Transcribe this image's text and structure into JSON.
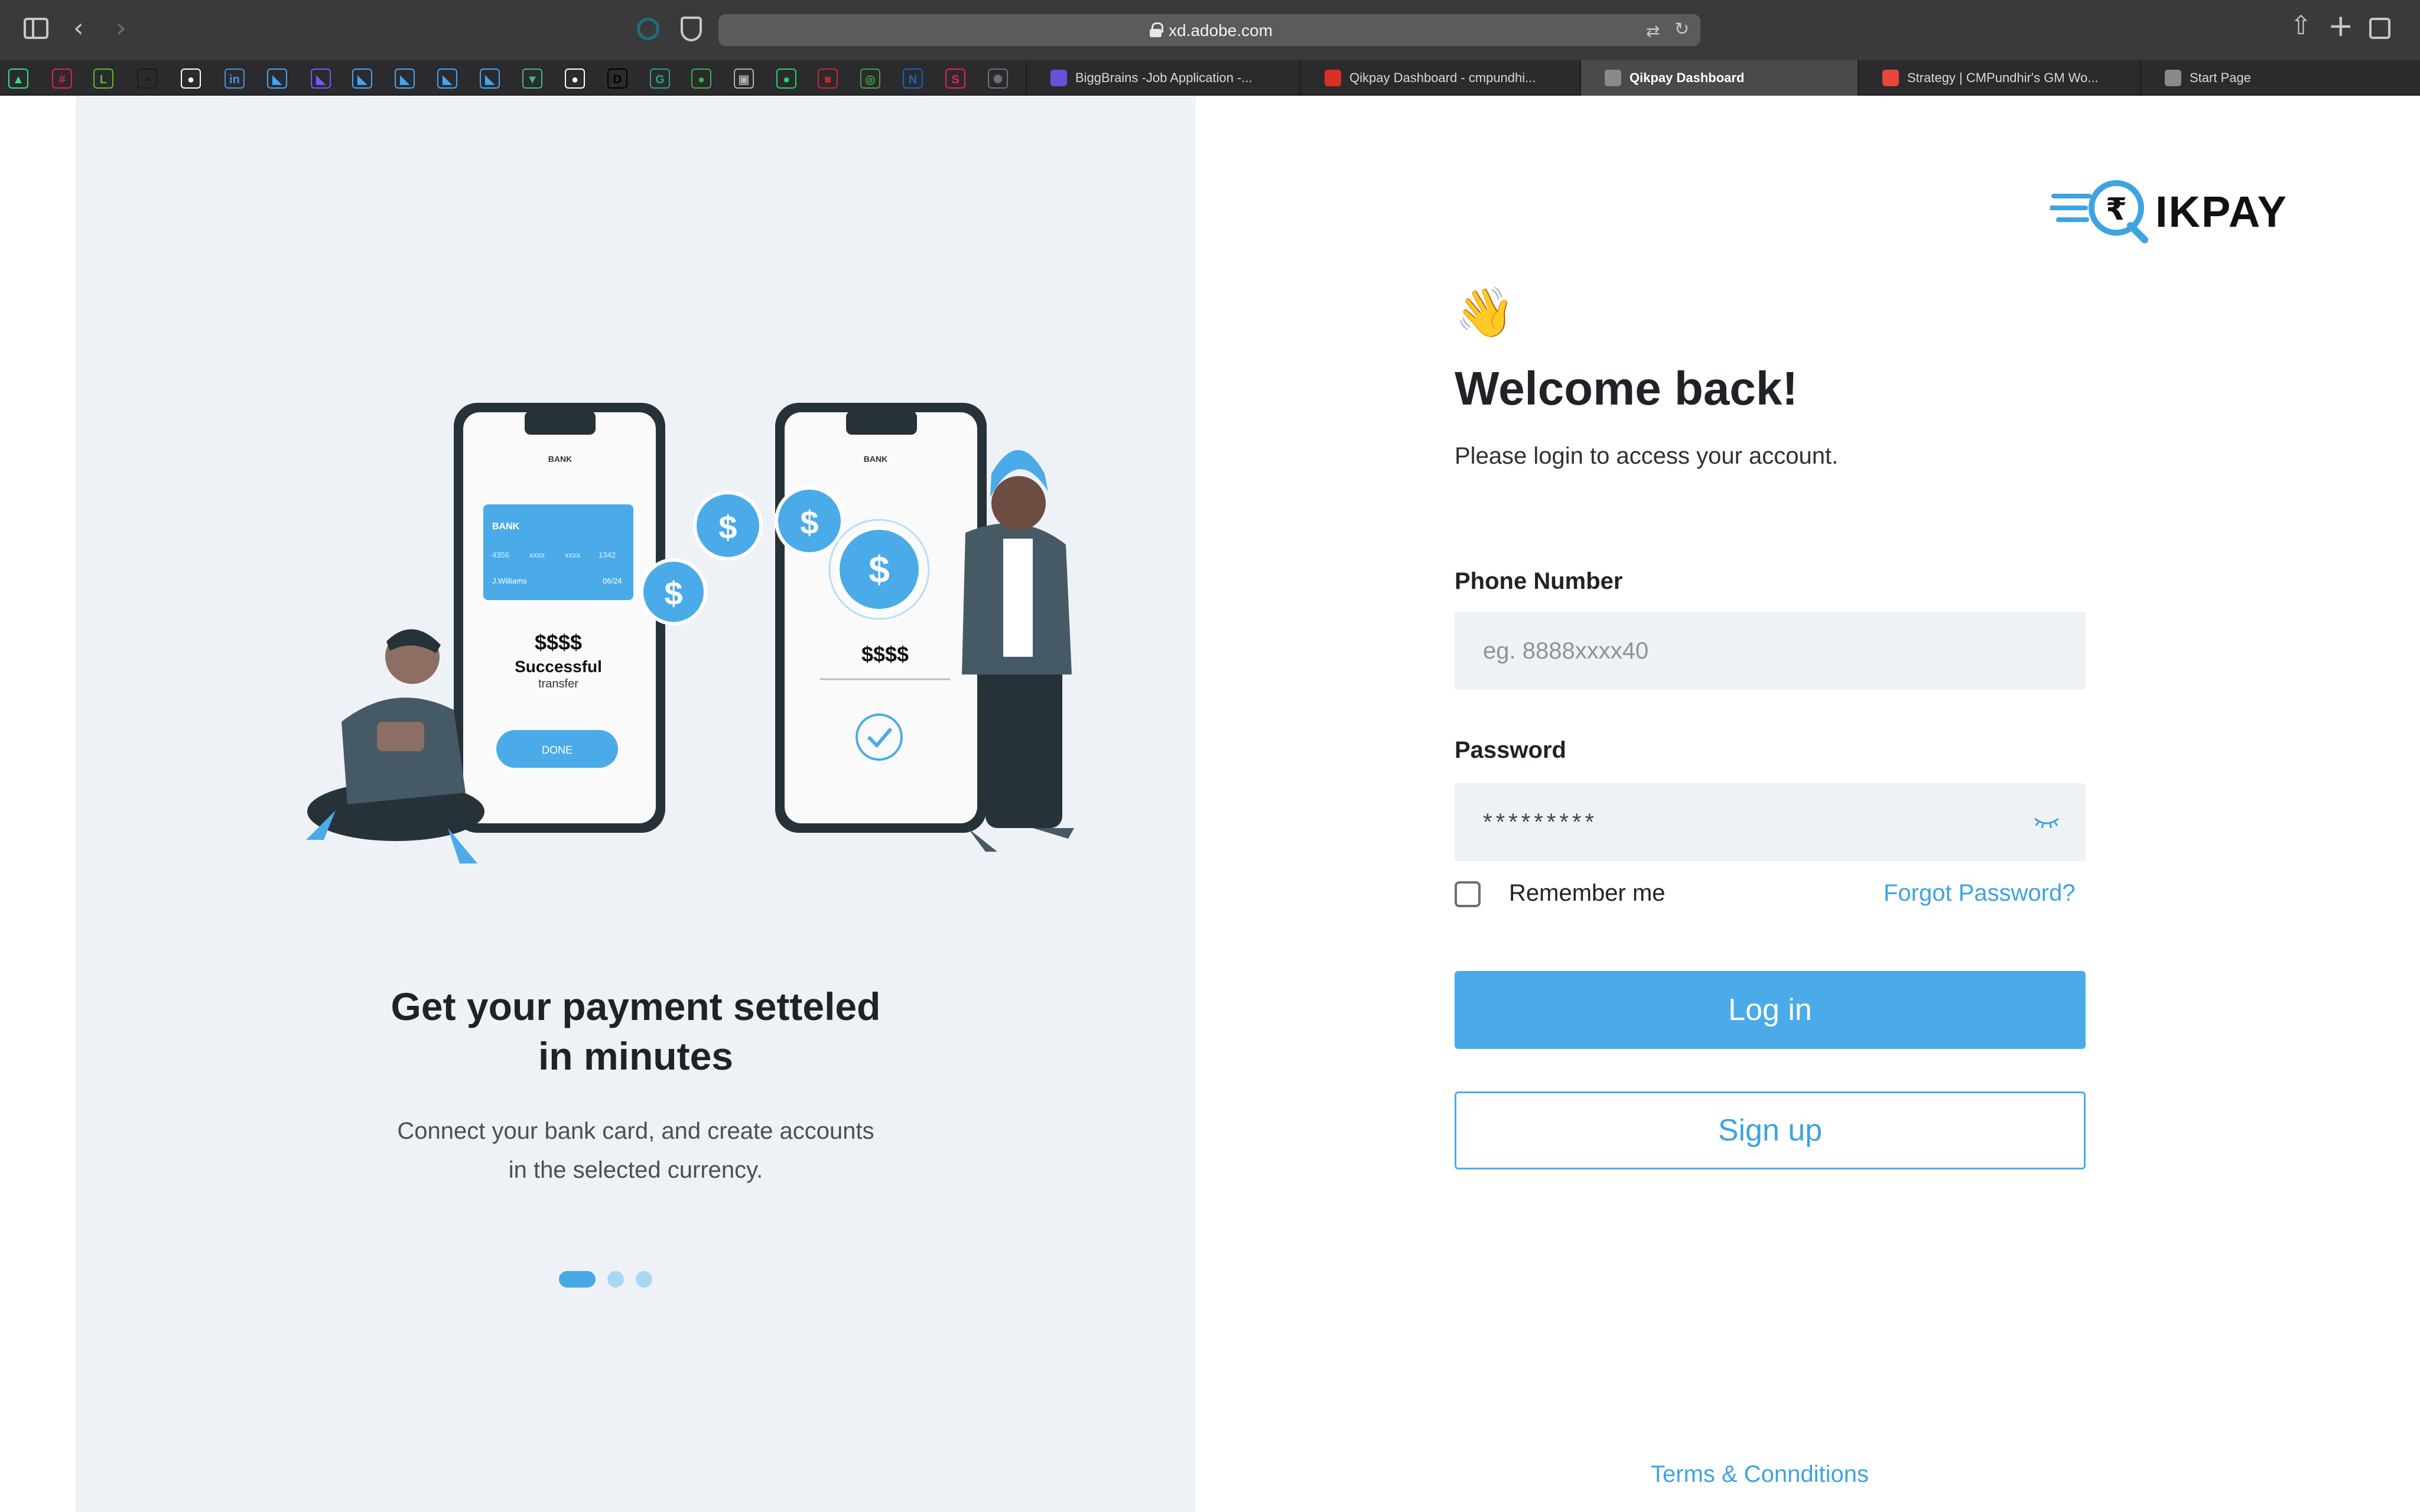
{
  "browser": {
    "url": "xd.adobe.com",
    "tabs": [
      {
        "label": "BiggBrains -Job Application -...",
        "icon_color": "#6b4fd8",
        "active": false
      },
      {
        "label": "Qikpay Dashboard - cmpundhi...",
        "icon_color": "#d93025",
        "active": false
      },
      {
        "label": "Qikpay Dashboard",
        "icon_color": "#8a8a8e",
        "active": true
      },
      {
        "label": "Strategy | CMPundhir's GM Wo...",
        "icon_color": "#e8453c",
        "active": false
      },
      {
        "label": "Start Page",
        "icon_color": "#8a8a8e",
        "active": false
      }
    ],
    "favorites": [
      {
        "name": "android-icon",
        "color": "#3ddc84",
        "glyph": "▲"
      },
      {
        "name": "slack-icon",
        "color": "#e01e5a",
        "glyph": "#"
      },
      {
        "name": "l-icon",
        "color": "#5cb82e",
        "glyph": "L"
      },
      {
        "name": "app-icon",
        "color": "#1a1a1a",
        "glyph": "•"
      },
      {
        "name": "github-icon",
        "color": "#ffffff",
        "glyph": "●"
      },
      {
        "name": "invision-icon",
        "color": "#4a90e2",
        "glyph": "in"
      },
      {
        "name": "flutter-icon",
        "color": "#42a5f5",
        "glyph": "◣"
      },
      {
        "name": "kotlin-icon",
        "color": "#7f52ff",
        "glyph": "◣"
      },
      {
        "name": "flutter-icon",
        "color": "#42a5f5",
        "glyph": "◣"
      },
      {
        "name": "flutter-icon",
        "color": "#42a5f5",
        "glyph": "◣"
      },
      {
        "name": "flutter-icon",
        "color": "#42a5f5",
        "glyph": "◣"
      },
      {
        "name": "flutter-icon",
        "color": "#42a5f5",
        "glyph": "◣"
      },
      {
        "name": "vue-icon",
        "color": "#41b883",
        "glyph": "▼"
      },
      {
        "name": "github-icon",
        "color": "#ffffff",
        "glyph": "●"
      },
      {
        "name": "dev-icon",
        "color": "#000000",
        "glyph": "D"
      },
      {
        "name": "gt-icon",
        "color": "#2d9c8f",
        "glyph": "G"
      },
      {
        "name": "green-icon",
        "color": "#3cb043",
        "glyph": "●"
      },
      {
        "name": "image-icon",
        "color": "#b0b0b0",
        "glyph": "▣"
      },
      {
        "name": "whatsapp-icon",
        "color": "#25d366",
        "glyph": "●"
      },
      {
        "name": "red-icon",
        "color": "#c62828",
        "glyph": "■"
      },
      {
        "name": "green-circle-icon",
        "color": "#43a047",
        "glyph": "◎"
      },
      {
        "name": "nd-icon",
        "color": "#1565c0",
        "glyph": "N"
      },
      {
        "name": "s-icon",
        "color": "#e91e63",
        "glyph": "S"
      },
      {
        "name": "gear-icon",
        "color": "#707080",
        "glyph": "✺"
      }
    ]
  },
  "left": {
    "headline_line1": "Get your payment setteled",
    "headline_line2": "in minutes",
    "subline_line1": "Connect your bank card, and create accounts",
    "subline_line2": "in the selected currency.",
    "carousel_active_index": 0,
    "illustration": {
      "bank": "BANK",
      "card_number_start": "4356",
      "card_number_mask1": "xxxx",
      "card_number_mask2": "xxxx",
      "card_number_end": "1342",
      "card_holder": "J.Williams",
      "card_expiry": "06/24",
      "amount": "$$$$",
      "success": "Successful",
      "transfer": "transfer",
      "done": "DONE",
      "dollar": "$"
    }
  },
  "right": {
    "logo_text": "IKPAY",
    "logo_symbol": "₹",
    "wave_emoji": "👋",
    "welcome": "Welcome back!",
    "subtitle": "Please login to access your account.",
    "phone_label": "Phone Number",
    "phone_placeholder": "eg. 8888xxxx40",
    "password_label": "Password",
    "password_value": "*********",
    "remember_label": "Remember me",
    "remember_checked": false,
    "forgot_label": "Forgot Password?",
    "login_label": "Log in",
    "signup_label": "Sign up",
    "terms_label": "Terms & Connditions"
  },
  "colors": {
    "accent": "#4aabe8",
    "panel_bg": "#eef2f6",
    "text_dark": "#1f2328"
  }
}
